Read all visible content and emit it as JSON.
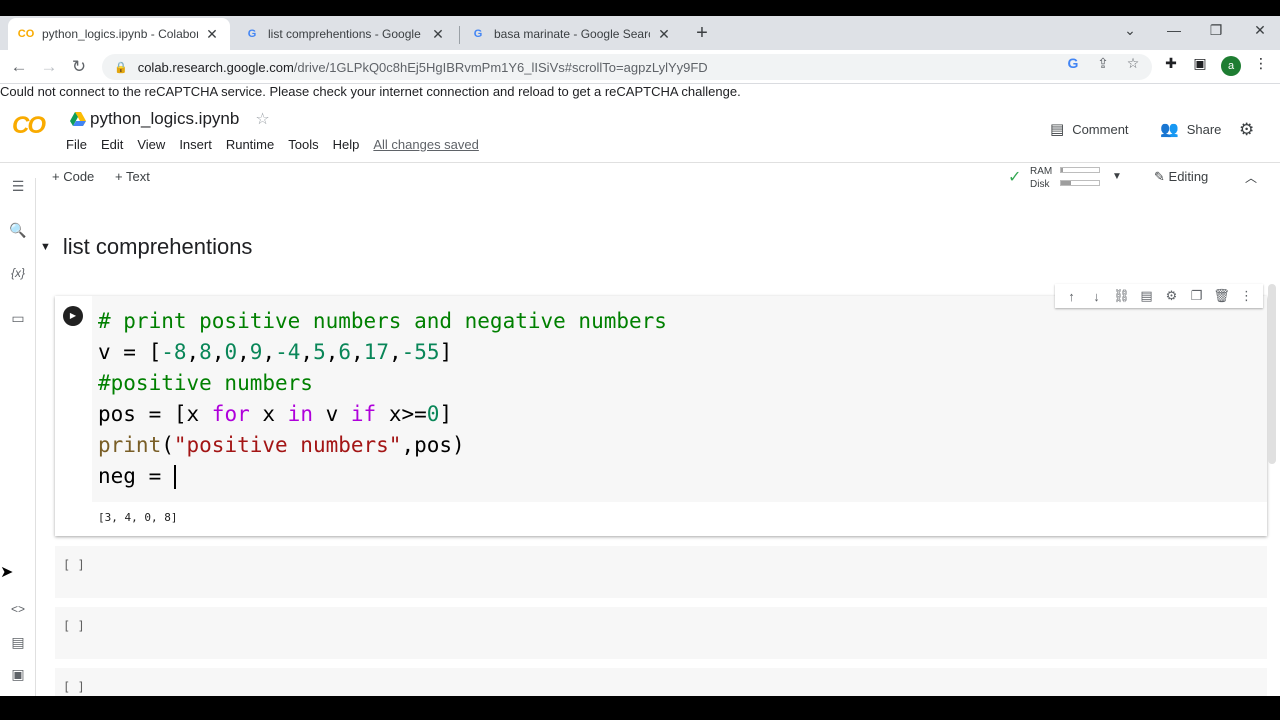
{
  "browser": {
    "tabs": [
      {
        "title": "python_logics.ipynb - Colaborato",
        "favicon": "CO"
      },
      {
        "title": "list comprehentions - Google Se",
        "favicon": "G"
      },
      {
        "title": "basa marinate - Google Search",
        "favicon": "G"
      }
    ],
    "url_host": "colab.research.google.com",
    "url_path": "/drive/1GLPkQ0c8hEj5HgIBRvmPm1Y6_lISiVs#scrollTo=agpzLylYy9FD",
    "profile_initial": "a"
  },
  "captcha_message": "Could not connect to the reCAPTCHA service. Please check your internet connection and reload to get a reCAPTCHA challenge.",
  "colab": {
    "logo": "CO",
    "notebook_title": "python_logics.ipynb",
    "menu": [
      "File",
      "Edit",
      "View",
      "Insert",
      "Runtime",
      "Tools",
      "Help"
    ],
    "save_status": "All changes saved",
    "comment_label": "Comment",
    "share_label": "Share",
    "add_code_label": "+ Code",
    "add_text_label": "+ Text",
    "ram_label": "RAM",
    "disk_label": "Disk",
    "ram_fraction": 0.05,
    "disk_fraction": 0.25,
    "editing_label": "Editing",
    "section_title": "list comprehentions",
    "output": "[3, 4, 0, 8]",
    "empty_cell_bracket": "[ ]"
  },
  "colors": {
    "comment": "#008000",
    "number": "#098658",
    "keyword": "#af00db",
    "string": "#a31515",
    "colab_orange": "#f9ab00"
  }
}
